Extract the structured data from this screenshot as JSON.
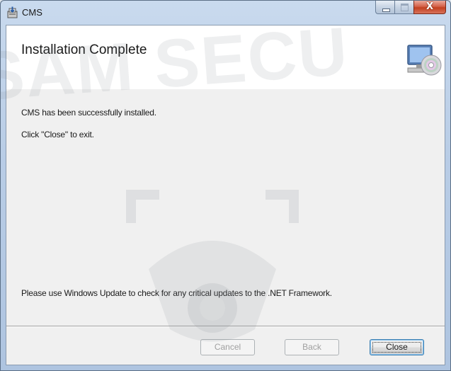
{
  "window": {
    "title": "CMS",
    "close_glyph": "X"
  },
  "banner": {
    "title": "Installation Complete",
    "icon": "computer-with-disc-icon"
  },
  "body": {
    "message_installed": "CMS has been successfully installed.",
    "message_exit": "Click \"Close\" to exit.",
    "message_update": "Please use Windows Update to check for any critical updates to the .NET Framework."
  },
  "buttons": {
    "cancel": "Cancel",
    "back": "Back",
    "close": "Close"
  },
  "watermark": {
    "text": "SAM SECU"
  },
  "colors": {
    "titlebar": "#b9cde6",
    "client_bg": "#f0f0f0",
    "close_button": "#c2401f",
    "default_button_border": "#3c7fb1"
  }
}
